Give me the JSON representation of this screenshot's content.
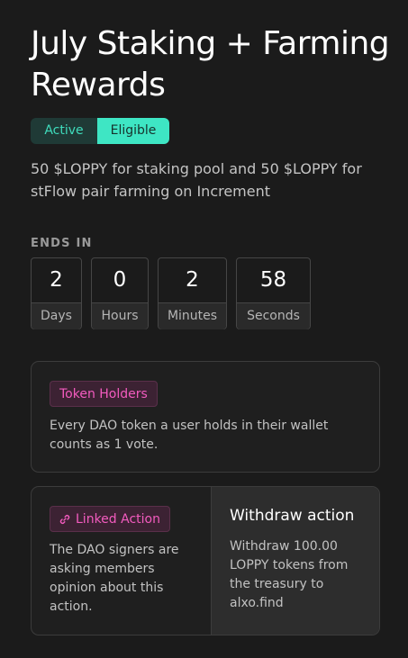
{
  "proposal": {
    "title": "July Staking + Farming Rewards",
    "status_badge": "Active",
    "eligibility_badge": "Eligible",
    "description": "50 $LOPPY for staking pool and 50 $LOPPY for stFlow pair farming on Increment"
  },
  "countdown": {
    "label": "ENDS IN",
    "items": [
      {
        "value": "2",
        "unit": "Days"
      },
      {
        "value": "0",
        "unit": "Hours"
      },
      {
        "value": "2",
        "unit": "Minutes"
      },
      {
        "value": "58",
        "unit": "Seconds"
      }
    ]
  },
  "strategy_card": {
    "tag": "Token Holders",
    "text": "Every DAO token a user holds in their wallet counts as 1 vote."
  },
  "linked_action_card": {
    "tag": "Linked Action",
    "tag_icon": "link-icon",
    "text": "The DAO signers are asking members opinion about this action.",
    "action_title": "Withdraw action",
    "action_text": "Withdraw 100.00 LOPPY tokens from the treasury to alxo.find"
  },
  "colors": {
    "background": "#1b1b1b",
    "accent_teal": "#3ee6c4",
    "accent_pink": "#f35bbf"
  }
}
